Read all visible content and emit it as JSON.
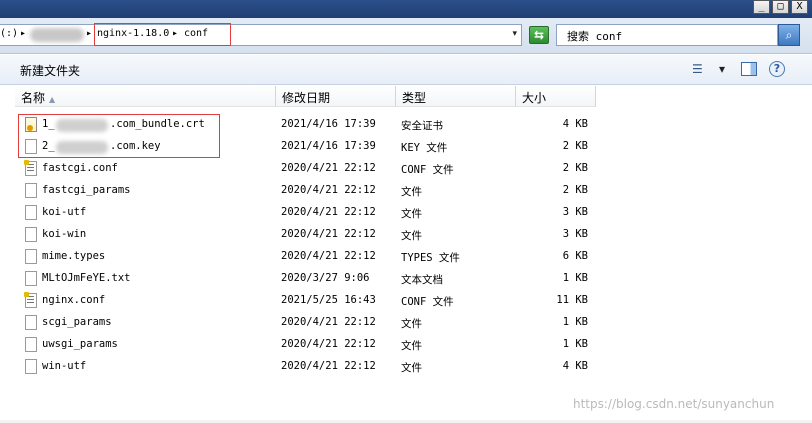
{
  "window": {
    "minimize_glyph": "_",
    "maximize_glyph": "□",
    "close_glyph": "X"
  },
  "address": {
    "drive_fragment": "(:)",
    "sep1": "▸",
    "sep2": "▸",
    "crumb_nginx": "nginx-1.18.0",
    "sep3": "▸",
    "crumb_conf": "conf",
    "dropdown_glyph": "▾",
    "refresh_glyph": "⇆"
  },
  "search": {
    "text": "搜索 conf",
    "button_glyph": "⌕"
  },
  "toolbar": {
    "new_folder_label": "新建文件夹",
    "view_glyph": "☰",
    "view_dropdown_glyph": "▾",
    "help_glyph": "?"
  },
  "columns": {
    "name": "名称",
    "date": "修改日期",
    "type": "类型",
    "size": "大小",
    "sort_glyph": "▲"
  },
  "files": [
    {
      "name_prefix": "1_",
      "name_suffix": ".com_bundle.crt",
      "date": "2021/4/16 17:39",
      "type": "安全证书",
      "size": "4 KB",
      "icon": "certificate-icon"
    },
    {
      "name_prefix": "2_",
      "name_suffix": ".com.key",
      "date": "2021/4/16 17:39",
      "type": "KEY 文件",
      "size": "2 KB",
      "icon": "file-icon"
    },
    {
      "name": "fastcgi.conf",
      "date": "2020/4/21 22:12",
      "type": "CONF 文件",
      "size": "2 KB",
      "icon": "conf-file-icon"
    },
    {
      "name": "fastcgi_params",
      "date": "2020/4/21 22:12",
      "type": "文件",
      "size": "2 KB",
      "icon": "file-icon"
    },
    {
      "name": "koi-utf",
      "date": "2020/4/21 22:12",
      "type": "文件",
      "size": "3 KB",
      "icon": "file-icon"
    },
    {
      "name": "koi-win",
      "date": "2020/4/21 22:12",
      "type": "文件",
      "size": "3 KB",
      "icon": "file-icon"
    },
    {
      "name": "mime.types",
      "date": "2020/4/21 22:12",
      "type": "TYPES 文件",
      "size": "6 KB",
      "icon": "file-icon"
    },
    {
      "name": "MLtOJmFeYE.txt",
      "date": "2020/3/27 9:06",
      "type": "文本文档",
      "size": "1 KB",
      "icon": "text-file-icon"
    },
    {
      "name": "nginx.conf",
      "date": "2021/5/25 16:43",
      "type": "CONF 文件",
      "size": "11 KB",
      "icon": "conf-file-icon"
    },
    {
      "name": "scgi_params",
      "date": "2020/4/21 22:12",
      "type": "文件",
      "size": "1 KB",
      "icon": "file-icon"
    },
    {
      "name": "uwsgi_params",
      "date": "2020/4/21 22:12",
      "type": "文件",
      "size": "1 KB",
      "icon": "file-icon"
    },
    {
      "name": "win-utf",
      "date": "2020/4/21 22:12",
      "type": "文件",
      "size": "4 KB",
      "icon": "file-icon"
    }
  ],
  "watermark": "https://blog.csdn.net/sunyanchun",
  "colors": {
    "highlight_box": "#e23c3c",
    "titlebar": "#2b4f8a"
  }
}
